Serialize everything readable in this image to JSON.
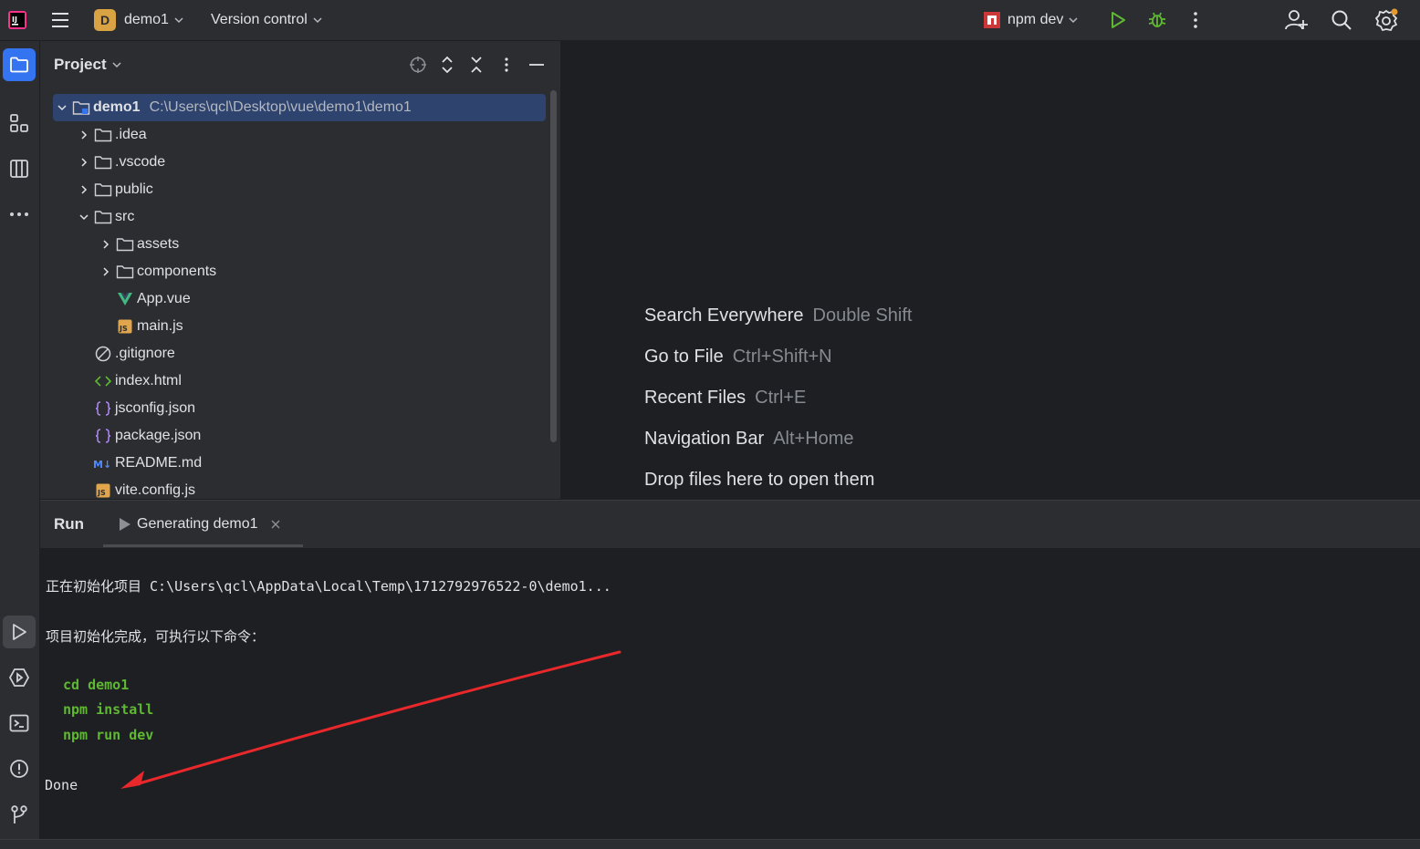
{
  "titlebar": {
    "project_badge": "D",
    "project_name": "demo1",
    "vcs_label": "Version control",
    "run_config": "npm dev"
  },
  "project_panel": {
    "title": "Project",
    "root": {
      "name": "demo1",
      "path": "C:\\Users\\qcl\\Desktop\\vue\\demo1\\demo1"
    },
    "items": [
      {
        "label": ".idea"
      },
      {
        "label": ".vscode"
      },
      {
        "label": "public"
      },
      {
        "label": "src"
      },
      {
        "label": "assets"
      },
      {
        "label": "components"
      },
      {
        "label": "App.vue"
      },
      {
        "label": "main.js"
      },
      {
        "label": ".gitignore"
      },
      {
        "label": "index.html"
      },
      {
        "label": "jsconfig.json"
      },
      {
        "label": "package.json"
      },
      {
        "label": "README.md"
      },
      {
        "label": "vite.config.js"
      }
    ]
  },
  "editor_hints": [
    {
      "action": "Search Everywhere",
      "shortcut": "Double Shift"
    },
    {
      "action": "Go to File",
      "shortcut": "Ctrl+Shift+N"
    },
    {
      "action": "Recent Files",
      "shortcut": "Ctrl+E"
    },
    {
      "action": "Navigation Bar",
      "shortcut": "Alt+Home"
    },
    {
      "action": "Drop files here to open them",
      "shortcut": ""
    }
  ],
  "run_panel": {
    "title": "Run",
    "tab_label": "Generating demo1",
    "console": {
      "line1": "正在初始化项目 C:\\Users\\qcl\\AppData\\Local\\Temp\\1712792976522-0\\demo1...",
      "line2": "项目初始化完成，可执行以下命令：",
      "cmd1": "cd demo1",
      "cmd2": "npm install",
      "cmd3": "npm run dev",
      "done": "Done"
    }
  },
  "colors": {
    "accent": "#3574f0",
    "selection": "#2e436e",
    "command_green": "#5fb832",
    "annotation_arrow": "#e8282b",
    "run_green": "#5fb832"
  }
}
